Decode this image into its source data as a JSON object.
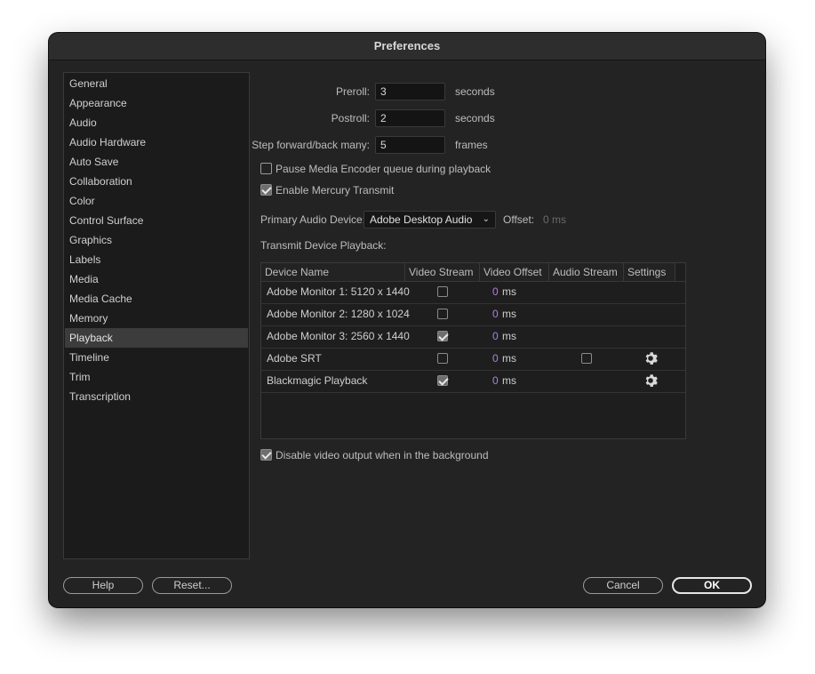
{
  "window": {
    "title": "Preferences"
  },
  "sidebar": {
    "items": [
      {
        "label": "General"
      },
      {
        "label": "Appearance"
      },
      {
        "label": "Audio"
      },
      {
        "label": "Audio Hardware"
      },
      {
        "label": "Auto Save"
      },
      {
        "label": "Collaboration"
      },
      {
        "label": "Color"
      },
      {
        "label": "Control Surface"
      },
      {
        "label": "Graphics"
      },
      {
        "label": "Labels"
      },
      {
        "label": "Media"
      },
      {
        "label": "Media Cache"
      },
      {
        "label": "Memory"
      },
      {
        "label": "Playback"
      },
      {
        "label": "Timeline"
      },
      {
        "label": "Trim"
      },
      {
        "label": "Transcription"
      }
    ],
    "selected": "Playback"
  },
  "playback": {
    "preroll": {
      "label": "Preroll:",
      "value": "3",
      "unit": "seconds"
    },
    "postroll": {
      "label": "Postroll:",
      "value": "2",
      "unit": "seconds"
    },
    "step": {
      "label": "Step forward/back many:",
      "value": "5",
      "unit": "frames"
    },
    "pause_media_encoder": {
      "label": "Pause Media Encoder queue during playback",
      "checked": false
    },
    "enable_mercury": {
      "label": "Enable Mercury Transmit",
      "checked": true
    },
    "primary_audio": {
      "label": "Primary Audio Device:",
      "value": "Adobe Desktop Audio",
      "offset_label": "Offset:",
      "offset_value": "0 ms"
    },
    "transmit_label": "Transmit Device Playback:",
    "table": {
      "headers": [
        "Device Name",
        "Video Stream",
        "Video Offset",
        "Audio Stream",
        "Settings"
      ],
      "rows": [
        {
          "name": "Adobe Monitor 1: 5120 x 1440",
          "video_stream": false,
          "offset": "0",
          "unit": "ms",
          "audio_stream": null,
          "settings": false
        },
        {
          "name": "Adobe Monitor 2: 1280 x 1024",
          "video_stream": false,
          "offset": "0",
          "unit": "ms",
          "audio_stream": null,
          "settings": false
        },
        {
          "name": "Adobe Monitor 3: 2560 x 1440",
          "video_stream": true,
          "offset": "0",
          "unit": "ms",
          "audio_stream": null,
          "settings": false
        },
        {
          "name": "Adobe SRT",
          "video_stream": false,
          "offset": "0",
          "unit": "ms",
          "audio_stream": false,
          "settings": true
        },
        {
          "name": "Blackmagic Playback",
          "video_stream": true,
          "offset": "0",
          "unit": "ms",
          "audio_stream": null,
          "settings": true
        }
      ]
    },
    "disable_background": {
      "label": "Disable video output when in the background",
      "checked": true
    }
  },
  "buttons": {
    "help": "Help",
    "reset": "Reset...",
    "cancel": "Cancel",
    "ok": "OK"
  },
  "icons": {
    "settings": "gear-icon",
    "dropdown": "chevron-down-icon",
    "checkmark": "checkmark-icon"
  }
}
